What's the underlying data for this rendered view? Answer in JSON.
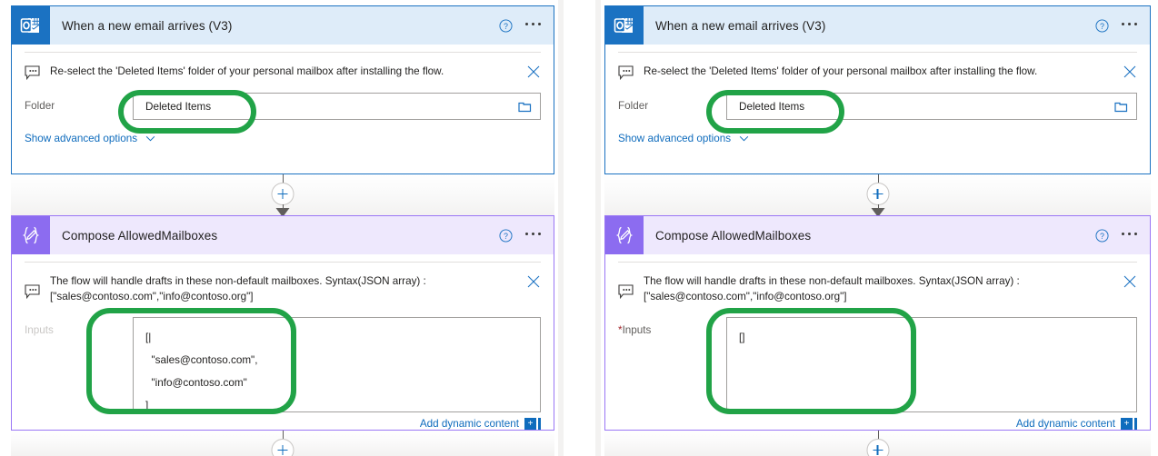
{
  "colors": {
    "trigger_accent": "#1b72c2",
    "trigger_header_bg": "#deecf9",
    "action_accent": "#8c6cf0",
    "action_header_bg": "#eee8fd",
    "link": "#0f6cbd",
    "annotation_green": "#21a347",
    "required_asterisk": "#a4262c"
  },
  "panels": [
    {
      "id": "left",
      "cards": [
        {
          "id": "trigger",
          "kind": "trigger",
          "icon": "outlook-icon",
          "title": "When a new email arrives (V3)",
          "help_icon": "help-circle-icon",
          "more_icon": "ellipsis-icon",
          "note": {
            "icon": "comment-icon",
            "text": "Re-select the 'Deleted Items' folder of your personal mailbox after installing the flow.",
            "close_icon": "close-icon"
          },
          "param": {
            "label": "Folder",
            "required": false,
            "faded": false,
            "value": "Deleted Items",
            "picker_icon": "folder-picker-icon"
          },
          "advanced_label": "Show advanced options",
          "advanced_icon": "chevron-down-icon"
        },
        {
          "id": "compose",
          "kind": "action",
          "icon": "compose-braces-pencil-icon",
          "title": "Compose AllowedMailboxes",
          "help_icon": "help-circle-icon",
          "more_icon": "ellipsis-icon",
          "note": {
            "icon": "comment-icon",
            "text": "The flow will handle drafts in these non-default mailboxes. Syntax(JSON array) :\n[\"sales@contoso.com\",\"info@contoso.org\"]",
            "close_icon": "close-icon"
          },
          "param": {
            "label": "Inputs",
            "required": false,
            "faded": true,
            "value": "[|\n  \"sales@contoso.com\",\n  \"info@contoso.com\"\n]"
          },
          "add_dynamic_content": {
            "label": "Add dynamic content",
            "plus": "+",
            "plus_icon": "add-dynamic-content-icon"
          }
        }
      ]
    },
    {
      "id": "right",
      "cards": [
        {
          "id": "trigger",
          "kind": "trigger",
          "icon": "outlook-icon",
          "title": "When a new email arrives (V3)",
          "help_icon": "help-circle-icon",
          "more_icon": "ellipsis-icon",
          "note": {
            "icon": "comment-icon",
            "text": "Re-select the 'Deleted Items' folder of your personal mailbox after installing the flow.",
            "close_icon": "close-icon"
          },
          "param": {
            "label": "Folder",
            "required": false,
            "faded": false,
            "value": "Deleted Items",
            "picker_icon": "folder-picker-icon"
          },
          "advanced_label": "Show advanced options",
          "advanced_icon": "chevron-down-icon"
        },
        {
          "id": "compose",
          "kind": "action",
          "icon": "compose-braces-pencil-icon",
          "title": "Compose AllowedMailboxes",
          "help_icon": "help-circle-icon",
          "more_icon": "ellipsis-icon",
          "note": {
            "icon": "comment-icon",
            "text": "The flow will handle drafts in these non-default mailboxes. Syntax(JSON array) :\n[\"sales@contoso.com\",\"info@contoso.org\"]",
            "close_icon": "close-icon"
          },
          "param": {
            "label": "Inputs",
            "required": true,
            "required_mark": "*",
            "faded": false,
            "value": "[]"
          },
          "add_dynamic_content": {
            "label": "Add dynamic content",
            "plus": "+",
            "plus_icon": "add-dynamic-content-icon"
          }
        }
      ]
    }
  ],
  "connectors": {
    "insert_icon": "insert-step-plus-icon",
    "arrow_icon": "flow-arrow-icon"
  },
  "annotations": [
    {
      "id": "left-folder-highlight",
      "target": "folder field (left)"
    },
    {
      "id": "left-inputs-highlight",
      "target": "inputs textarea (left)"
    },
    {
      "id": "right-folder-highlight",
      "target": "folder field (right)"
    },
    {
      "id": "right-inputs-highlight",
      "target": "inputs textarea (right)"
    }
  ]
}
